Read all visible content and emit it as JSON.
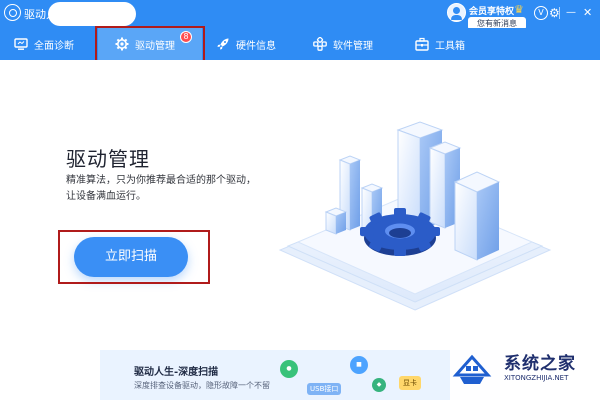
{
  "window": {
    "title": "驱动人生",
    "member_label": "会员享特权",
    "message_label": "您有新消息",
    "icons": [
      "app-logo-icon",
      "avatar-icon",
      "crown-icon",
      "vip-icon",
      "settings-icon",
      "minimize-icon",
      "close-icon"
    ]
  },
  "nav": {
    "items": [
      {
        "label": "全面诊断",
        "icon": "monitor-icon"
      },
      {
        "label": "驱动管理",
        "icon": "gear-icon",
        "active": true,
        "badge": "8"
      },
      {
        "label": "硬件信息",
        "icon": "rocket-icon"
      },
      {
        "label": "软件管理",
        "icon": "apps-icon"
      },
      {
        "label": "工具箱",
        "icon": "toolbox-icon"
      }
    ]
  },
  "main": {
    "title": "驱动管理",
    "desc_line1": "精准算法，只为你推荐最合适的那个驱动，",
    "desc_line2": "让设备满血运行。",
    "scan_button": "立即扫描"
  },
  "banner": {
    "title": "驱动人生-深度扫描",
    "desc": "深度排查设备驱动，隐形故障一个不留",
    "usb_tag": "USB接口",
    "card_tag": "显卡"
  },
  "watermark": {
    "text": "系统之家",
    "url": "XITONGZHIJIA.NET"
  },
  "colors": {
    "primary": "#2f8cf4",
    "active_tab": "#5aa6f7",
    "button": "#3a8ff5",
    "badge": "#ff4d4f",
    "highlight_box": "#b01b1b"
  }
}
